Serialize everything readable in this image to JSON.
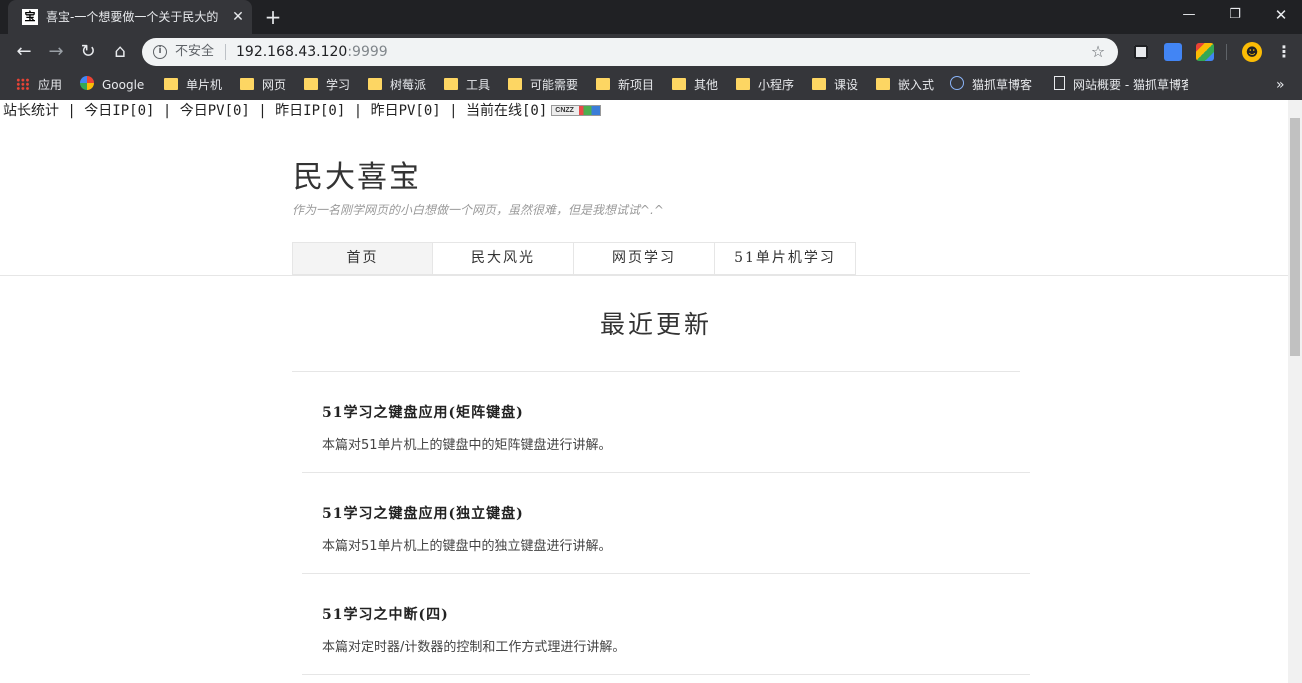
{
  "browser": {
    "tab_title": "喜宝-一个想要做一个关于民大的",
    "favicon_text": "宝",
    "address": {
      "security_label": "不安全",
      "host": "192.168.43.120",
      "port": ":9999"
    }
  },
  "bookmarks": [
    {
      "label": "应用",
      "icon": "apps-icon"
    },
    {
      "label": "Google",
      "icon": "google-icon"
    },
    {
      "label": "单片机",
      "icon": "folder-icon"
    },
    {
      "label": "网页",
      "icon": "folder-icon"
    },
    {
      "label": "学习",
      "icon": "folder-icon"
    },
    {
      "label": "树莓派",
      "icon": "folder-icon"
    },
    {
      "label": "工具",
      "icon": "folder-icon"
    },
    {
      "label": "可能需要",
      "icon": "folder-icon"
    },
    {
      "label": "新项目",
      "icon": "folder-icon"
    },
    {
      "label": "其他",
      "icon": "folder-icon"
    },
    {
      "label": "小程序",
      "icon": "folder-icon"
    },
    {
      "label": "课设",
      "icon": "folder-icon"
    },
    {
      "label": "嵌入式",
      "icon": "folder-icon"
    },
    {
      "label": "猫抓草博客",
      "icon": "site-icon"
    },
    {
      "label": "网站概要 - 猫抓草博客",
      "icon": "page-icon"
    }
  ],
  "page": {
    "stats_text": "站长统计 | 今日IP[0] | 今日PV[0] | 昨日IP[0] | 昨日PV[0] | 当前在线[0]",
    "stats_badge": "CNZZ",
    "site_title": "民大喜宝",
    "site_description": "作为一名刚学网页的小白想做一个网页，虽然很难，但是我想试试^.^",
    "nav": [
      "首页",
      "民大风光",
      "网页学习",
      "51单片机学习"
    ],
    "section_title": "最近更新",
    "posts": [
      {
        "title": "51学习之键盘应用(矩阵键盘)",
        "description": "本篇对51单片机上的键盘中的矩阵键盘进行讲解。"
      },
      {
        "title": "51学习之键盘应用(独立键盘)",
        "description": "本篇对51单片机上的键盘中的独立键盘进行讲解。"
      },
      {
        "title": "51学习之中断(四)",
        "description": "本篇对定时器/计数器的控制和工作方式理进行讲解。"
      }
    ]
  }
}
